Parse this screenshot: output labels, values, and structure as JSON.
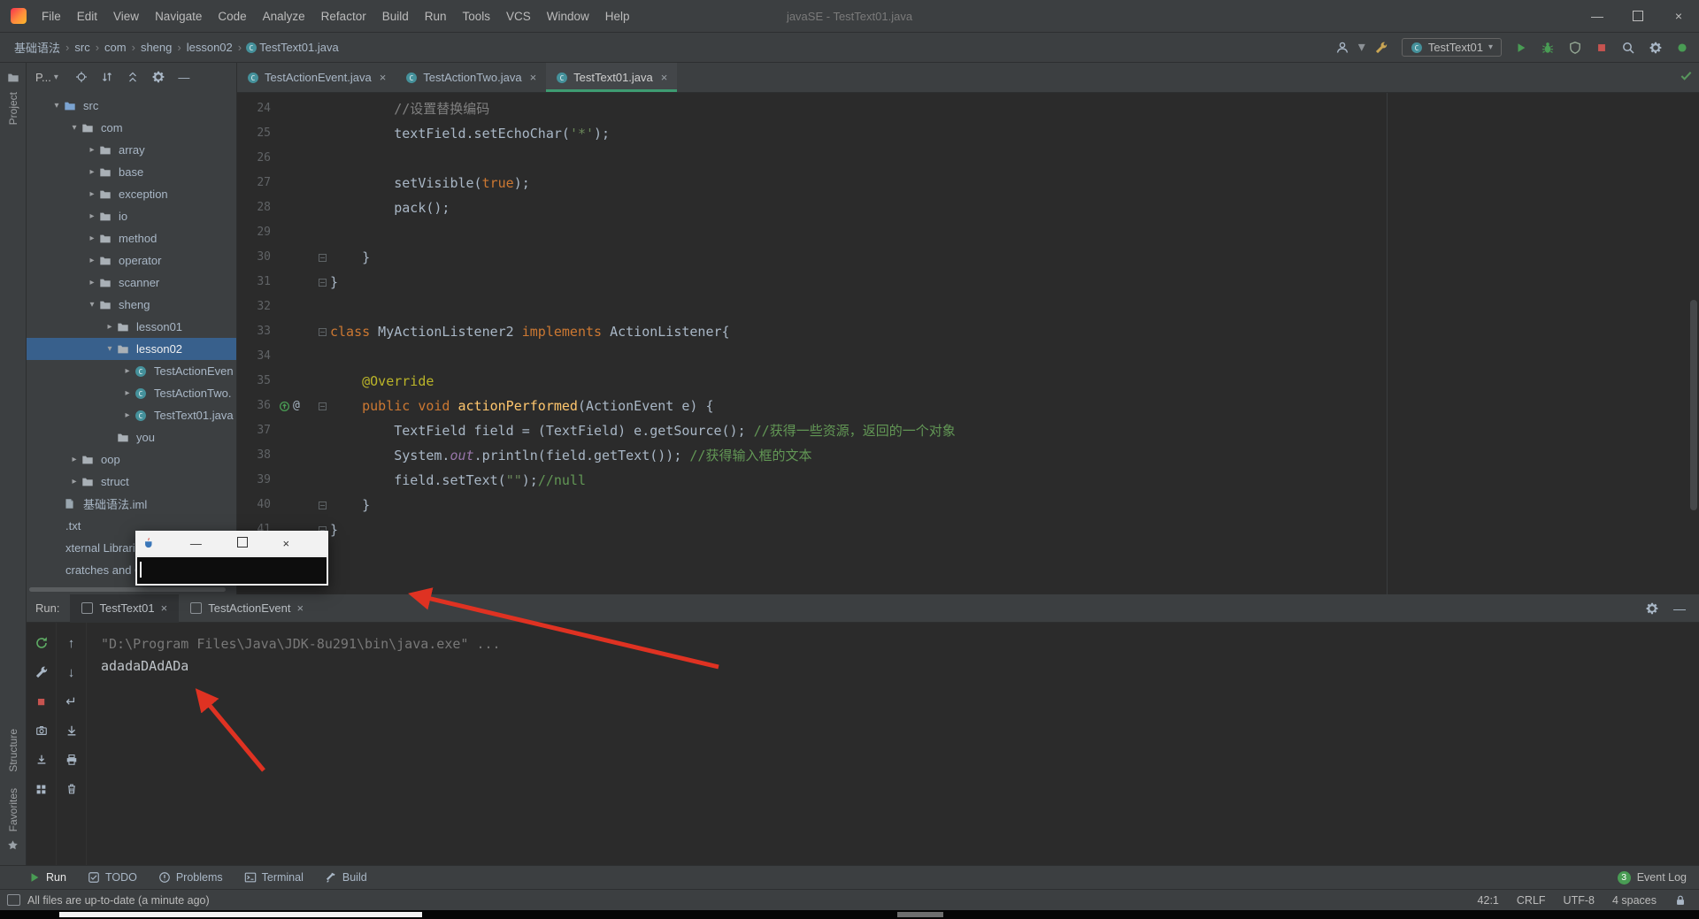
{
  "titlebar": {
    "menu": [
      "File",
      "Edit",
      "View",
      "Navigate",
      "Code",
      "Analyze",
      "Refactor",
      "Build",
      "Run",
      "Tools",
      "VCS",
      "Window",
      "Help"
    ],
    "title": "javaSE - TestText01.java",
    "controls": {
      "minimize": "—",
      "close": "×"
    }
  },
  "navbar": {
    "breadcrumbs": [
      "基础语法",
      "src",
      "com",
      "sheng",
      "lesson02",
      "TestText01.java"
    ],
    "separator": "›",
    "run_config_label": "TestText01",
    "left_icons": [
      {
        "name": "user-icon",
        "svg": "user",
        "color": "#A9B7C6"
      },
      {
        "name": "user-dropdown-icon",
        "glyph": "▾",
        "color": "#8C9196"
      },
      {
        "name": "wrench-icon",
        "svg": "wrench",
        "color": "#C9A554"
      }
    ],
    "right_icons": [
      {
        "name": "run-button",
        "svg": "play",
        "color": "#499C54"
      },
      {
        "name": "debug-button",
        "svg": "bug",
        "color": "#499C54"
      },
      {
        "name": "coverage-button",
        "svg": "shield",
        "color": "#93A693"
      },
      {
        "name": "stop-button",
        "svg": "square",
        "color": "#C75450"
      },
      {
        "name": "search-everywhere-icon",
        "svg": "search",
        "color": "#A9B7C6"
      },
      {
        "name": "settings-icon",
        "svg": "gear",
        "color": "#A9B7C6"
      },
      {
        "name": "status-circle-icon",
        "svg": "dot",
        "color": "#499C54"
      }
    ]
  },
  "stripe": {
    "project": "Project",
    "structure": "Structure",
    "favorites": "Favorites"
  },
  "project": {
    "header_label": "P...",
    "header_caret": "▾",
    "header_icons": [
      {
        "name": "locate-icon",
        "svg": "locate"
      },
      {
        "name": "expand-collapse-icon",
        "svg": "updown"
      },
      {
        "name": "collapse-all-icon",
        "svg": "collapse"
      },
      {
        "name": "panel-settings-icon",
        "svg": "gear"
      },
      {
        "name": "hide-panel-icon",
        "glyph": "—"
      }
    ],
    "items": [
      {
        "label": "src",
        "indent": 1,
        "arrow": "down",
        "icon": "folder",
        "icon_color": "#7BA3D0"
      },
      {
        "label": "com",
        "indent": 2,
        "arrow": "down",
        "icon": "folder"
      },
      {
        "label": "array",
        "indent": 3,
        "arrow": "right",
        "icon": "folder"
      },
      {
        "label": "base",
        "indent": 3,
        "arrow": "right",
        "icon": "folder"
      },
      {
        "label": "exception",
        "indent": 3,
        "arrow": "right",
        "icon": "folder"
      },
      {
        "label": "io",
        "indent": 3,
        "arrow": "right",
        "icon": "folder"
      },
      {
        "label": "method",
        "indent": 3,
        "arrow": "right",
        "icon": "folder"
      },
      {
        "label": "operator",
        "indent": 3,
        "arrow": "right",
        "icon": "folder"
      },
      {
        "label": "scanner",
        "indent": 3,
        "arrow": "right",
        "icon": "folder"
      },
      {
        "label": "sheng",
        "indent": 3,
        "arrow": "down",
        "icon": "folder"
      },
      {
        "label": "lesson01",
        "indent": 4,
        "arrow": "right",
        "icon": "folder"
      },
      {
        "label": "lesson02",
        "indent": 4,
        "arrow": "down",
        "icon": "folder",
        "selected": true
      },
      {
        "label": "TestActionEven",
        "indent": 5,
        "arrow": "right",
        "icon": "class"
      },
      {
        "label": "TestActionTwo.",
        "indent": 5,
        "arrow": "right",
        "icon": "class"
      },
      {
        "label": "TestText01.java",
        "indent": 5,
        "arrow": "right",
        "icon": "class"
      },
      {
        "label": "you",
        "indent": 4,
        "arrow": "",
        "icon": "folder"
      },
      {
        "label": "oop",
        "indent": 2,
        "arrow": "right",
        "icon": "folder"
      },
      {
        "label": "struct",
        "indent": 2,
        "arrow": "right",
        "icon": "folder"
      },
      {
        "label": "基础语法.iml",
        "indent": 1,
        "arrow": "",
        "icon": "module"
      },
      {
        "label": ".txt",
        "indent": 0,
        "arrow": "",
        "icon": ""
      },
      {
        "label": "xternal Libraries",
        "indent": 0,
        "arrow": "",
        "icon": ""
      },
      {
        "label": "cratches and Con",
        "indent": 0,
        "arrow": "",
        "icon": ""
      }
    ]
  },
  "editor": {
    "tabs": [
      {
        "label": "TestActionEvent.java"
      },
      {
        "label": "TestActionTwo.java"
      },
      {
        "label": "TestText01.java",
        "active": true
      }
    ],
    "close_glyph": "×",
    "lines": [
      {
        "n": "24",
        "seg": [
          [
            "        //设置替换编码",
            "com"
          ]
        ]
      },
      {
        "n": "25",
        "seg": [
          [
            "        textField.setEchoChar(",
            "def"
          ],
          [
            "'*'",
            "str"
          ],
          [
            ");",
            "def"
          ]
        ]
      },
      {
        "n": "26",
        "seg": []
      },
      {
        "n": "27",
        "seg": [
          [
            "        setVisible(",
            "def"
          ],
          [
            "true",
            "kw"
          ],
          [
            ");",
            "def"
          ]
        ]
      },
      {
        "n": "28",
        "seg": [
          [
            "        pack();",
            "def"
          ]
        ]
      },
      {
        "n": "29",
        "seg": []
      },
      {
        "n": "30",
        "fold": true,
        "seg": [
          [
            "    }",
            "def"
          ]
        ]
      },
      {
        "n": "31",
        "fold": true,
        "seg": [
          [
            "}",
            "def"
          ]
        ]
      },
      {
        "n": "32",
        "seg": []
      },
      {
        "n": "33",
        "fold": true,
        "seg": [
          [
            "class",
            "kw"
          ],
          [
            " MyActionListener2 ",
            "def"
          ],
          [
            "implements",
            "kw"
          ],
          [
            " ActionListener{",
            "def"
          ]
        ]
      },
      {
        "n": "34",
        "seg": []
      },
      {
        "n": "35",
        "seg": [
          [
            "    ",
            "def"
          ],
          [
            "@Override",
            "ann"
          ]
        ]
      },
      {
        "n": "36",
        "fold": true,
        "override": true,
        "seg": [
          [
            "    ",
            "def"
          ],
          [
            "public",
            "kw"
          ],
          [
            " ",
            "def"
          ],
          [
            "void",
            "kw"
          ],
          [
            " ",
            "def"
          ],
          [
            "actionPerformed",
            "meth"
          ],
          [
            "(ActionEvent e) {",
            "def"
          ]
        ]
      },
      {
        "n": "37",
        "seg": [
          [
            "        TextField field = (TextField) e.getSource(); ",
            "def"
          ],
          [
            "//获得一些资源，返回的一个对象",
            "comg"
          ]
        ]
      },
      {
        "n": "38",
        "seg": [
          [
            "        System.",
            "def"
          ],
          [
            "out",
            "field"
          ],
          [
            ".println(field.getText()); ",
            "def"
          ],
          [
            "//获得输入框的文本",
            "comg"
          ]
        ]
      },
      {
        "n": "39",
        "seg": [
          [
            "        field.setText(",
            "def"
          ],
          [
            "\"\"",
            "str"
          ],
          [
            ");",
            "def"
          ],
          [
            "//null",
            "comg"
          ]
        ]
      },
      {
        "n": "40",
        "fold": true,
        "seg": [
          [
            "    }",
            "def"
          ]
        ]
      },
      {
        "n": "41",
        "fold": true,
        "seg": [
          [
            "}",
            "def"
          ]
        ]
      }
    ]
  },
  "popup": {
    "min": "—",
    "close": "×"
  },
  "run": {
    "label": "Run:",
    "tabs": [
      {
        "label": "TestText01",
        "active": true
      },
      {
        "label": "TestActionEvent"
      }
    ],
    "close_glyph": "×",
    "bar_icons": [
      {
        "name": "run-settings-icon",
        "svg": "gear"
      },
      {
        "name": "hide-run-panel-icon",
        "glyph": "—"
      }
    ],
    "toolbar_outer": [
      {
        "name": "rerun-icon",
        "svg": "rerun",
        "color": "#5FAD65"
      },
      {
        "name": "build-wrench-icon",
        "svg": "wrench",
        "color": "#A9B7C6"
      },
      {
        "name": "stop-icon",
        "glyph": "■",
        "color": "#C75450"
      },
      {
        "name": "screenshot-icon",
        "svg": "camera",
        "color": "#A9B7C6"
      },
      {
        "name": "dump-threads-icon",
        "svg": "importx",
        "color": "#A9B7C6"
      },
      {
        "name": "restore-layout-icon",
        "svg": "grid",
        "color": "#A9B7C6"
      }
    ],
    "toolbar_inner": [
      {
        "name": "up-stacktrace-icon",
        "glyph": "↑",
        "color": "#A9B7C6"
      },
      {
        "name": "down-stacktrace-icon",
        "glyph": "↓",
        "color": "#A9B7C6"
      },
      {
        "name": "soft-wrap-icon",
        "glyph": "↵",
        "color": "#A9B7C6"
      },
      {
        "name": "scroll-to-end-icon",
        "svg": "scrollend",
        "color": "#A9B7C6"
      },
      {
        "name": "print-icon",
        "svg": "print",
        "color": "#A9B7C6"
      },
      {
        "name": "clear-all-icon",
        "svg": "trash",
        "color": "#A9B7C6"
      }
    ],
    "console": [
      {
        "text": "\"D:\\Program Files\\Java\\JDK-8u291\\bin\\java.exe\" ...",
        "style": "dim"
      },
      {
        "text": "adadaDAdADa",
        "style": "normal"
      }
    ]
  },
  "toolwindow_bar": {
    "items": [
      {
        "label": "Run",
        "svg": "play",
        "color": "#499C54",
        "active": true
      },
      {
        "label": "TODO",
        "svg": "todo"
      },
      {
        "label": "Problems",
        "svg": "warn"
      },
      {
        "label": "Terminal",
        "svg": "terminal"
      },
      {
        "label": "Build",
        "svg": "hammer"
      }
    ],
    "event_log": {
      "badge": "3",
      "label": "Event Log"
    }
  },
  "statusbar": {
    "message": "All files are up-to-date (a minute ago)",
    "right": [
      "42:1",
      "CRLF",
      "UTF-8",
      "4 spaces"
    ]
  }
}
